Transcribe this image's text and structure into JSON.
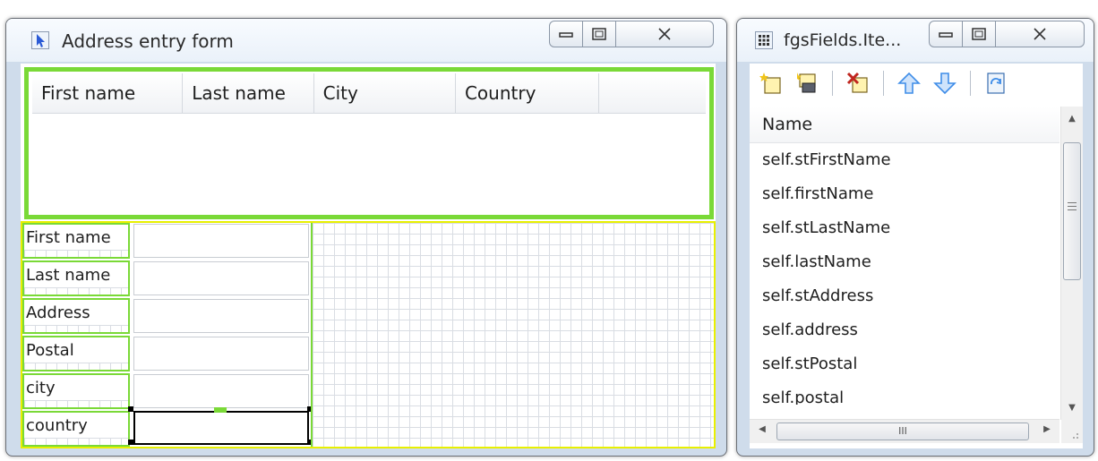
{
  "main_window": {
    "title": "Address entry form",
    "columns": [
      "First name",
      "Last name",
      "City",
      "Country"
    ],
    "fields": [
      {
        "label": "First name",
        "value": ""
      },
      {
        "label": "Last name",
        "value": ""
      },
      {
        "label": "Address",
        "value": ""
      },
      {
        "label": "Postal",
        "value": ""
      },
      {
        "label": "city",
        "value": ""
      },
      {
        "label": "country",
        "value": ""
      }
    ]
  },
  "side_window": {
    "title": "fgsFields.Ite...",
    "toolbar": [
      "new-item-icon",
      "insert-item-icon",
      "delete-item-icon",
      "move-up-icon",
      "move-down-icon",
      "properties-icon"
    ],
    "list_header": "Name",
    "items": [
      "self.stFirstName",
      "self.firstName",
      "self.stLastName",
      "self.lastName",
      "self.stAddress",
      "self.address",
      "self.stPostal",
      "self.postal"
    ],
    "hscroll_grip": "III"
  },
  "colors": {
    "selection_green": "#7ad937",
    "designer_border": "#e8f000",
    "arrow_blue": "#3f8de8",
    "delete_red": "#c0261f"
  }
}
